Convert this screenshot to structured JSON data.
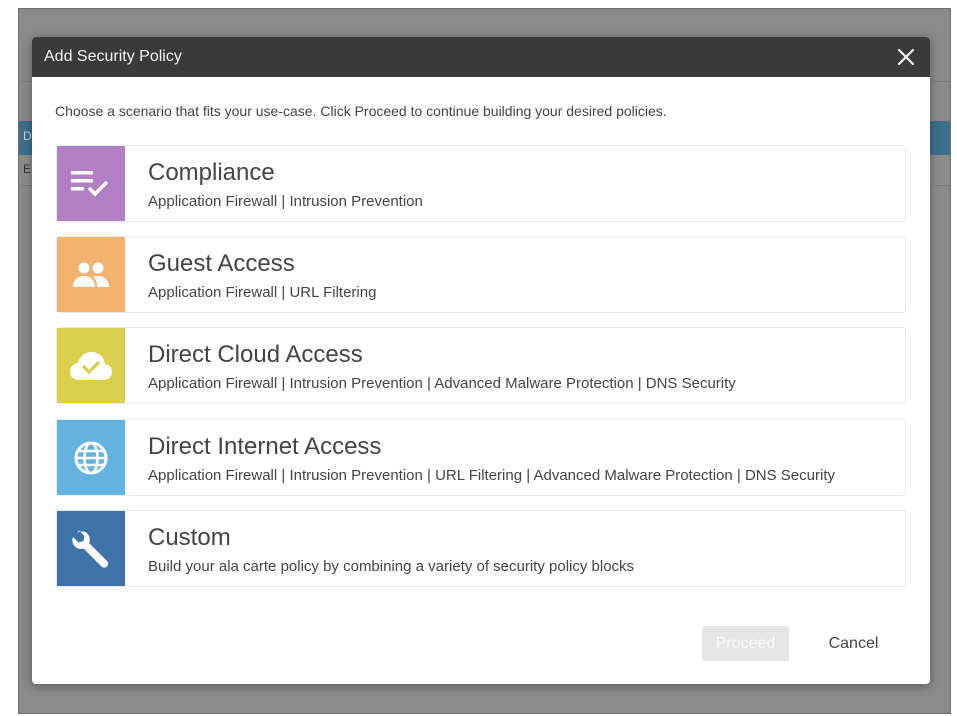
{
  "background": {
    "header_text": "D",
    "row_text": "E"
  },
  "modal": {
    "title": "Add Security Policy",
    "intro": "Choose a scenario that fits your use-case. Click Proceed to continue building your desired policies.",
    "scenarios": [
      {
        "title": "Compliance",
        "subtitle": "Application Firewall | Intrusion Prevention",
        "icon": "checklist-icon",
        "color": "#b17fc3"
      },
      {
        "title": "Guest Access",
        "subtitle": "Application Firewall | URL Filtering",
        "icon": "people-icon",
        "color": "#f4b26f"
      },
      {
        "title": "Direct Cloud Access",
        "subtitle": "Application Firewall | Intrusion Prevention | Advanced Malware Protection | DNS Security",
        "icon": "cloud-check-icon",
        "color": "#dccf4e"
      },
      {
        "title": "Direct Internet Access",
        "subtitle": "Application Firewall | Intrusion Prevention | URL Filtering | Advanced Malware Protection | DNS Security",
        "icon": "globe-icon",
        "color": "#64b2e0"
      },
      {
        "title": "Custom",
        "subtitle": "Build your ala carte policy by combining a variety of security policy blocks",
        "icon": "wrench-icon",
        "color": "#3e73a8"
      }
    ],
    "proceed_label": "Proceed",
    "cancel_label": "Cancel"
  }
}
